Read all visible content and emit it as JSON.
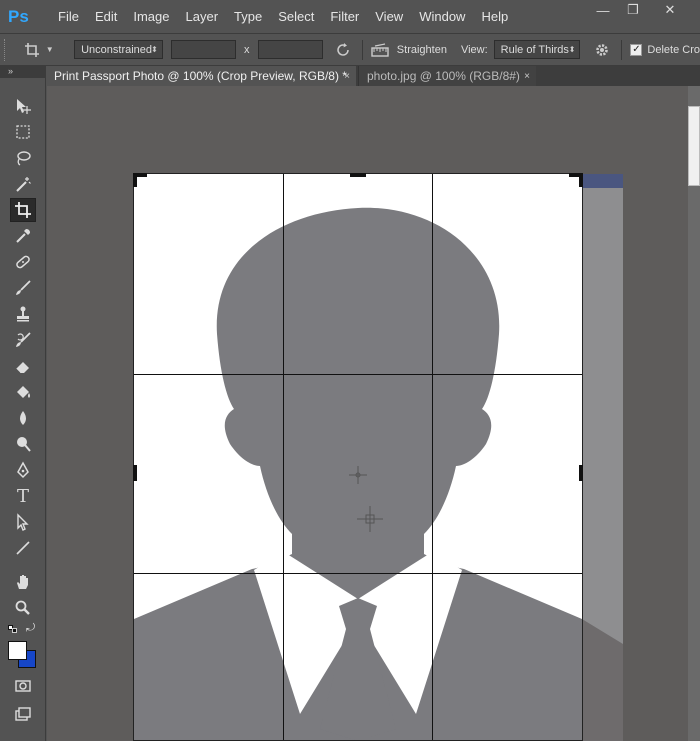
{
  "app": {
    "logo": "Ps"
  },
  "menu": [
    "File",
    "Edit",
    "Image",
    "Layer",
    "Type",
    "Select",
    "Filter",
    "View",
    "Window",
    "Help"
  ],
  "window_controls": {
    "minimize": "—",
    "restore": "❐",
    "close": "✕"
  },
  "options": {
    "ratio_select": "Unconstrained",
    "width_value": "",
    "height_value": "",
    "swap_label": "x",
    "straighten_label": "Straighten",
    "view_label": "View:",
    "view_select": "Rule of Thirds",
    "delete_cropped_label": "Delete Cro",
    "delete_cropped_checked": true
  },
  "tabs": [
    {
      "label": "Print Passport Photo @ 100% (Crop Preview, RGB/8) *",
      "close": "×",
      "active": true
    },
    {
      "label": "photo.jpg @ 100% (RGB/8#)",
      "close": "×",
      "active": false
    }
  ],
  "toolbox": {
    "header": "»",
    "tools": [
      "move-tool",
      "marquee-tool",
      "lasso-tool",
      "magic-wand-tool",
      "crop-tool",
      "eyedropper-tool",
      "healing-brush-tool",
      "brush-tool",
      "clone-stamp-tool",
      "history-brush-tool",
      "eraser-tool",
      "paint-bucket-tool",
      "blur-tool",
      "dodge-tool",
      "pen-tool",
      "type-tool",
      "path-selection-tool",
      "line-tool",
      "hand-tool",
      "zoom-tool"
    ],
    "active_tool": "crop-tool",
    "foreground_color": "#ffffff",
    "background_color": "#1646c8",
    "type_tool_glyph": "T"
  },
  "colors": {
    "ui_bg": "#535353",
    "canvas_bg": "#5e5c5b",
    "photo_bg": "#ffffff",
    "silhouette": "#7b7b7f",
    "accent": "#31a8ff"
  }
}
